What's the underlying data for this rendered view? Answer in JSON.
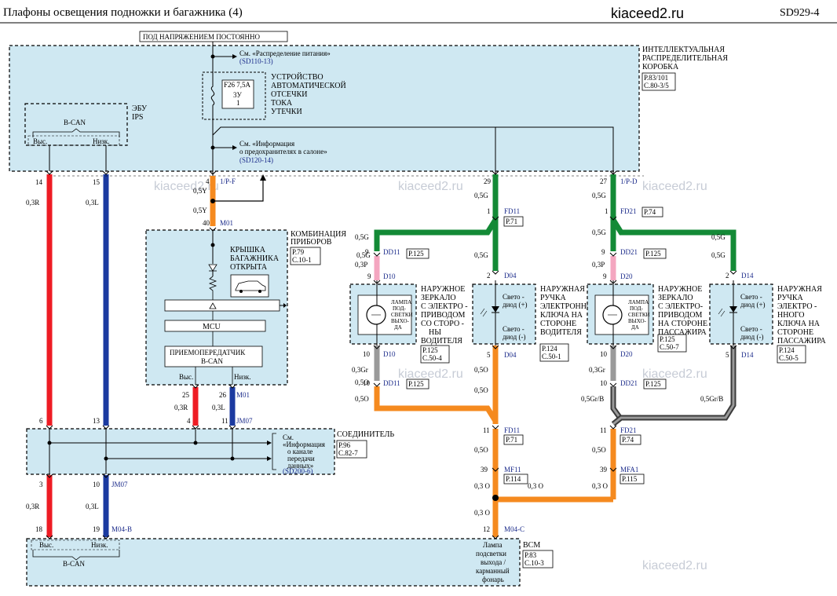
{
  "header": {
    "title": "Плафоны    освещения    подножки    и багажника    (4)",
    "site": "kiaceed2.ru",
    "code": "SD929-4"
  },
  "watermark": "kiaceed2.ru",
  "supply": {
    "label": "ПОД  НАПРЯЖЕНИЕМ   ПОСТОЯННО",
    "see1": "См. «Распределение       питания»",
    "see1_ref": "(SD110-13)",
    "fuse": "F26 7,5A",
    "fuse_sub1": "3У",
    "fuse_sub2": "1",
    "device": [
      "УСТРОЙСТВО",
      "АВТОМАТИЧЕСКОЙ",
      "ОТСЕЧКИ",
      "ТОКА",
      "УТЕЧКИ"
    ],
    "see2": "См. «Информация",
    "see2b": "о предохранителях        в салоне»",
    "see2_ref": "(SD120-14)"
  },
  "ibox": {
    "name": [
      "ИНТЕЛЛЕКТУАЛЬНАЯ",
      "РАСПРЕДЕЛИТЕЛЬНАЯ",
      "КОРОБКА"
    ],
    "ref1": "Р.83/101",
    "ref2": "С.80-3/5"
  },
  "ecu": {
    "name1": "ЭБУ",
    "name2": "IPS",
    "bus": "B-CAN",
    "high": "Выс.",
    "low": "Низк."
  },
  "cluster": {
    "name": [
      "КОМБИНАЦИЯ",
      "ПРИБОРОВ"
    ],
    "ref1": "Р.79",
    "ref2": "С.10-1",
    "trunk": [
      "КРЫШКА",
      "БАГАЖНИКА",
      "ОТКРЫТА"
    ],
    "mcu": "MCU",
    "trx1": "ПРИЕМОПЕРЕДАТЧИК",
    "trx2": "B-CAN",
    "high": "Выс.",
    "low": "Низк."
  },
  "connector": {
    "name": "СОЕДИНИТЕЛЬ",
    "ref1": "Р.96",
    "ref2": "С.82-7",
    "see": [
      "См.",
      "«Информация",
      "о канале",
      "передачи",
      "данных»"
    ],
    "see_ref": "(SD200-6)"
  },
  "bcm": {
    "name": "BCM",
    "ref1": "Р.83",
    "ref2": "С.10-3",
    "bus": "B-CAN",
    "high": "Выс.",
    "low": "Низк.",
    "lamp": [
      "Лампа",
      "подсветки",
      "выхода /",
      "карманный",
      "фонарь"
    ]
  },
  "mirror_drv": {
    "name": [
      "НАРУЖНОЕ",
      "ЗЕРКАЛО",
      "С ЭЛЕКТРО -",
      "ПРИВОДОМ",
      "СО  СТОРО -",
      "НЫ",
      "ВОДИТЕЛЯ"
    ],
    "lamp": [
      "ЛАМПА",
      "ПОД-",
      "СВЕТКИ",
      "ВЫХО-",
      "ДА"
    ],
    "ref1": "Р.125",
    "ref2": "С.50-4"
  },
  "handle_drv": {
    "name": [
      "НАРУЖНАЯ",
      "РУЧКА",
      "ЭЛЕКТРОННОГО",
      "КЛЮЧА НА",
      "СТОРОНЕ",
      "ВОДИТЕЛЯ"
    ],
    "led_plus": [
      "Свето -",
      "диод  (+)"
    ],
    "led_minus": [
      "Свето -",
      "диод  (-)"
    ],
    "ref1": "Р.124",
    "ref2": "С.50-1"
  },
  "mirror_pass": {
    "name": [
      "НАРУЖНОЕ",
      "ЗЕРКАЛО",
      "С ЭЛЕКТРО-",
      "ПРИВОДОМ",
      "НА СТОРОНЕ",
      "ПАССАЖИРА"
    ],
    "lamp": [
      "ЛАМПА",
      "ПОД-",
      "СВЕТКИ",
      "ВЫХО-",
      "ДА"
    ],
    "ref1": "Р.125",
    "ref2": "С.50-7"
  },
  "handle_pass": {
    "name": [
      "НАРУЖНАЯ",
      "РУЧКА",
      "ЭЛЕКТРО -",
      "ННОГО",
      "КЛЮЧА  НА",
      "СТОРОНЕ",
      "ПАССАЖИРА"
    ],
    "led_plus": [
      "Свето -",
      "диод (+)"
    ],
    "led_minus": [
      "Свето -",
      "диод (-)"
    ],
    "ref1": "Р.124",
    "ref2": "С.50-5"
  },
  "pins": {
    "p14": "14",
    "p15": "15",
    "p4": "4",
    "p40": "40",
    "p29": "29",
    "p27": "27",
    "p1a": "1",
    "p1b": "1",
    "p9a": "9",
    "p9b": "9",
    "p9c": "9",
    "p9d": "9",
    "p2a": "2",
    "p2b": "2",
    "p10a": "10",
    "p10b": "10",
    "p10c": "10",
    "p10d": "10",
    "p5a": "5",
    "p5b": "5",
    "p25": "25",
    "p26": "26",
    "p4b": "4",
    "p11a": "11",
    "p6": "6",
    "p13": "13",
    "p3": "3",
    "p10e": "10",
    "p11b": "11",
    "p11c": "11",
    "p39a": "39",
    "p39b": "39",
    "p18": "18",
    "p19": "19",
    "p12": "12"
  },
  "conns": {
    "pf": "1/P-F",
    "pd": "1/P-D",
    "m01a": "M01",
    "m01b": "M01",
    "fd11a": "FD11",
    "fd21a": "FD21",
    "dd11a": "DD11",
    "dd21a": "DD21",
    "d10a": "D10",
    "d10b": "D10",
    "d04a": "D04",
    "d04b": "D04",
    "d20a": "D20",
    "d20b": "D20",
    "d14a": "D14",
    "d14b": "D14",
    "dd11b": "DD11",
    "dd21b": "DD21",
    "jm07a": "JM07",
    "jm07b": "JM07",
    "fd11b": "FD11",
    "fd21b": "FD21",
    "mf11": "MF11",
    "mfa1": "MFA1",
    "m04b": "M04-B",
    "m04c": "M04-C"
  },
  "refs": {
    "fd11a": "Р.71",
    "fd21a": "Р.74",
    "dd11a": "Р.125",
    "dd21a": "Р.125",
    "dd11b": "Р.125",
    "dd21b": "Р.125",
    "fd11b": "Р.71",
    "fd21b": "Р.74",
    "mf11": "Р.114",
    "mfa1": "Р.115"
  },
  "wires": {
    "r03a": "0,3R",
    "l03a": "0,3L",
    "y05a": "0,5Y",
    "y05b": "0,5Y",
    "g05a": "0,5G",
    "g05b": "0,5G",
    "g05c": "0,5G",
    "g05d": "0,5G",
    "g05e": "0,5G",
    "g05f": "0,5G",
    "g05g": "0,5G",
    "g05h": "0,5G",
    "p03a": "0,3P",
    "p03b": "0,3P",
    "gr03a": "0,3Gr",
    "gr03b": "0,3Gr",
    "o05a": "0,5O",
    "o05b": "0,5O",
    "o05c": "0,5O",
    "o05d": "0,5O",
    "grb05a": "0,5Gr/B",
    "grb05b": "0,5Gr/B",
    "r03b": "0,3R",
    "l03b": "0,3L",
    "r03c": "0,3R",
    "l03c": "0,3L",
    "o05e": "0,5O",
    "o05f": "0,5O",
    "o03a": "0,3 O",
    "o03b": "0,3 O",
    "o03c": "0,3 O",
    "o03d": "0,3 O"
  },
  "colors": {
    "red": "#ee1c24",
    "blue": "#1b3aa0",
    "orange": "#f58a1f",
    "green": "#138a36",
    "pink": "#f4a6c0",
    "gray": "#9a9a9a",
    "graydark": "#3b3b3b",
    "panel": "#cfe8f2"
  }
}
